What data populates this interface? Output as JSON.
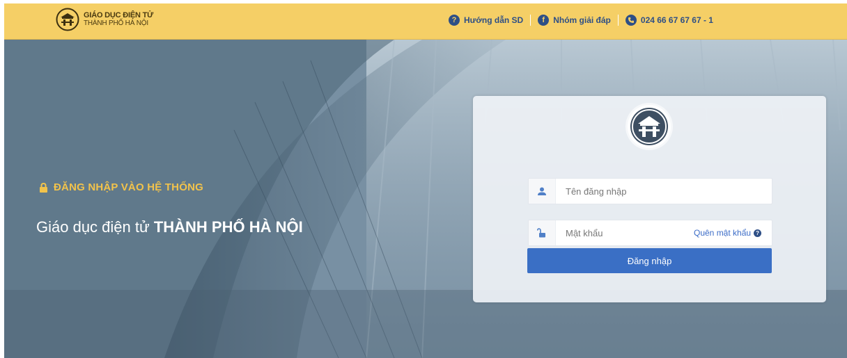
{
  "header": {
    "brand_line1": "GIÁO DỤC ĐIỆN TỬ",
    "brand_line2": "THÀNH PHỐ HÀ NỘI",
    "links": [
      {
        "label": "Hướng dẫn SD",
        "icon": "help-icon"
      },
      {
        "label": "Nhóm giải đáp",
        "icon": "facebook-icon"
      },
      {
        "label": "024 66 67 67 67 - 1",
        "icon": "phone-icon"
      }
    ]
  },
  "hero": {
    "title": "ĐĂNG NHẬP VÀO HỆ THỐNG",
    "subtitle_prefix": "Giáo dục điện tử ",
    "subtitle_bold": "THÀNH PHỐ HÀ NỘI"
  },
  "login": {
    "username_placeholder": "Tên đăng nhập",
    "password_placeholder": "Mật khẩu",
    "forgot_label": "Quên mật khẩu",
    "submit_label": "Đăng nhập"
  },
  "colors": {
    "topbar": "#f5cf66",
    "accent_blue": "#3a6fc5",
    "title_yellow": "#f2c34b"
  }
}
